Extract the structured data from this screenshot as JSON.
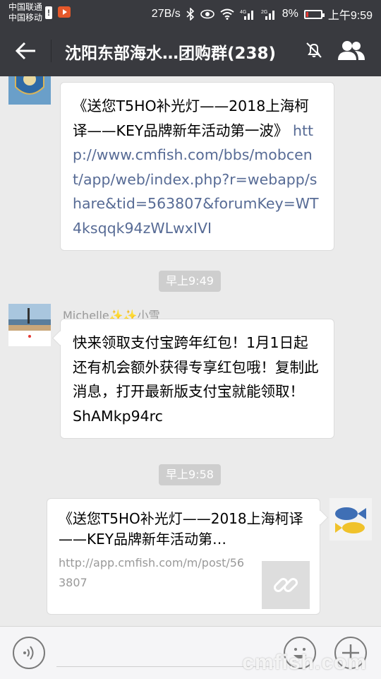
{
  "status_bar": {
    "carrier_1": "中国联通",
    "carrier_2": "中国移动",
    "net_speed": "27B/s",
    "battery": "8%",
    "time": "上午9:59"
  },
  "header": {
    "title": "沈阳东部海水…团购群(238)"
  },
  "messages": [
    {
      "type": "text",
      "prefix": "《送您T5HO补光灯——2018上海柯译——KEY品牌新年活动第一波》",
      "link": "http://www.cmfish.com/bbs/mobcent/app/web/index.php?r=webapp/share&tid=563807&forumKey=WT4ksqqk94zWLwxIVI"
    },
    {
      "type": "time",
      "text": "早上9:49"
    },
    {
      "type": "text",
      "sender": "Michelle✨✨小雪",
      "text": "快来领取支付宝跨年红包！1月1日起还有机会额外获得专享红包哦！复制此消息，打开最新版支付宝就能领取！ShAMkp94rc"
    },
    {
      "type": "time",
      "text": "早上9:58"
    },
    {
      "type": "link_card",
      "title": "《送您T5HO补光灯——2018上海柯译——KEY品牌新年活动第…",
      "url": "http://app.cmfish.com/m/post/563807"
    }
  ],
  "watermark": "cmfish.com",
  "colors": {
    "header_bg": "#393a3f",
    "chat_bg": "#ebebeb",
    "link": "#576b95",
    "time_pill": "#cecece"
  }
}
